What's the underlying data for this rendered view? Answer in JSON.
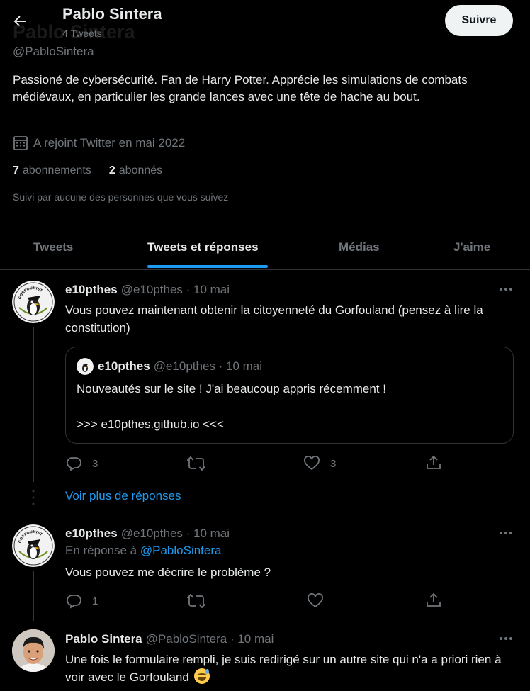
{
  "header": {
    "name": "Pablo Sintera",
    "ghost_name": "Pablo Sintera",
    "tweet_count": "4 Tweets",
    "follow_label": "Suivre",
    "back_icon": "arrow-left-icon"
  },
  "profile": {
    "handle": "@PabloSintera",
    "bio": "Passioné de cybersécurité. Fan de Harry Potter. Apprécie les simulations de combats médiévaux, en particulier les grande lances avec une tête de hache au bout.",
    "joined": "A rejoint Twitter en mai 2022",
    "following_count": "7",
    "following_label": "abonnements",
    "followers_count": "2",
    "followers_label": "abonnés",
    "followed_by": "Suivi par aucune des personnes que vous suivez"
  },
  "tabs": [
    {
      "label": "Tweets",
      "active": false
    },
    {
      "label": "Tweets et réponses",
      "active": true
    },
    {
      "label": "Médias",
      "active": false
    },
    {
      "label": "J'aime",
      "active": false
    }
  ],
  "tweets": [
    {
      "name": "e10pthes",
      "meta": "@e10pthes · 10 mai",
      "text": "Vous pouvez maintenant obtenir la citoyenneté du Gorfouland (pensez à lire la constitution)",
      "quote": {
        "name": "e10pthes",
        "meta": "@e10pthes · 10 mai",
        "line1": "Nouveautés sur le site ! J'ai beaucoup appris récemment !",
        "line2": ">>> e10pthes.github.io <<<"
      },
      "replies": "3",
      "retweets": "",
      "likes": "3"
    },
    {
      "name": "e10pthes",
      "meta": "@e10pthes · 10 mai",
      "reply_prefix": "En réponse à",
      "reply_handle": "@PabloSintera",
      "text": "Vous pouvez me décrire le problème ?",
      "replies": "1",
      "retweets": "",
      "likes": ""
    },
    {
      "name": "Pablo Sintera",
      "meta": "@PabloSintera · 10 mai",
      "text": "Une fois le formulaire rempli, je suis redirigé sur un autre site qui n'a a priori rien à voir avec le Gorfouland"
    }
  ],
  "see_more": "Voir plus de réponses",
  "avatar_text": "GORFOUNIST",
  "colors": {
    "accent": "#1d9bf0",
    "muted": "#71767b",
    "text": "#e7e9ea",
    "border": "#2f3336"
  }
}
